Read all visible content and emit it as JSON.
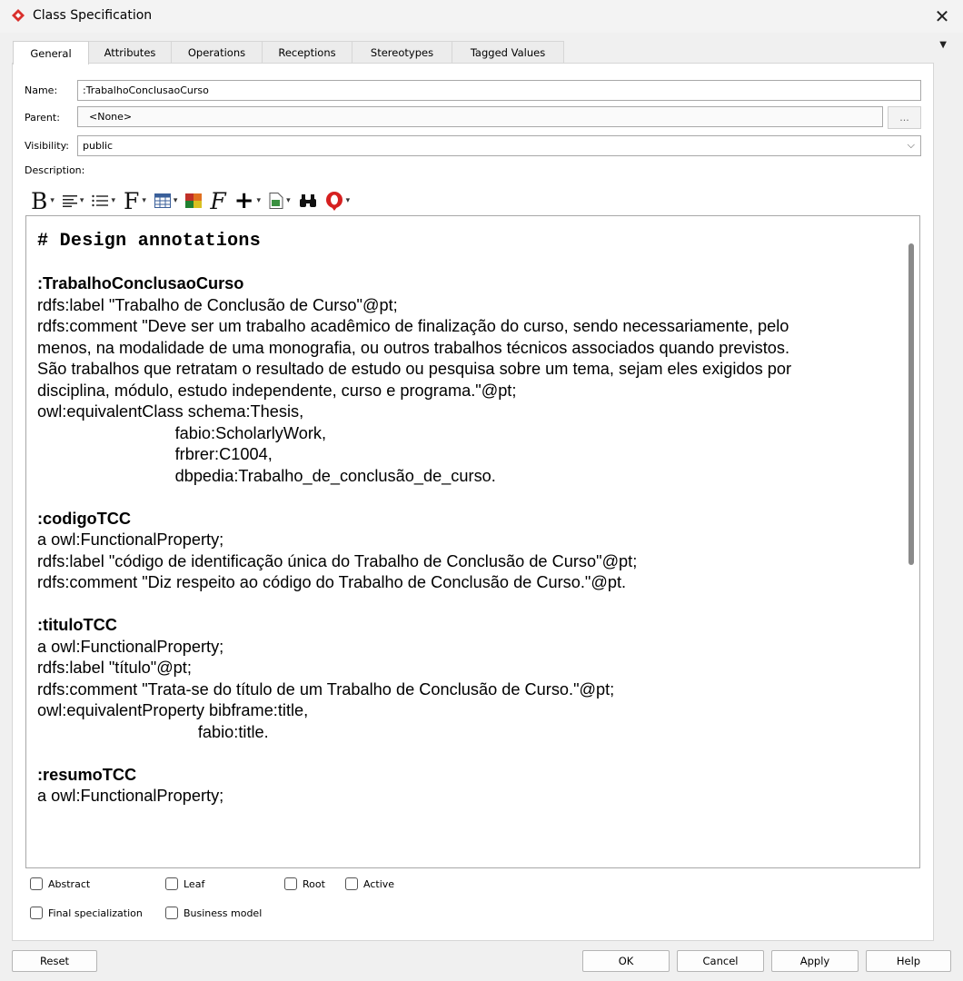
{
  "window": {
    "title": "Class Specification"
  },
  "tabs": [
    {
      "label": "General",
      "active": true
    },
    {
      "label": "Attributes"
    },
    {
      "label": "Operations"
    },
    {
      "label": "Receptions"
    },
    {
      "label": "Stereotypes"
    },
    {
      "label": "Tagged Values"
    }
  ],
  "form": {
    "name_label": "Name:",
    "name_value": ":TrabalhoConclusaoCurso",
    "parent_label": "Parent:",
    "parent_value": "<None>",
    "parent_button": "...",
    "visibility_label": "Visibility:",
    "visibility_value": "public",
    "description_label": "Description:"
  },
  "toolbar_icons": [
    "bold-icon",
    "align-icon",
    "list-icon",
    "font-icon",
    "table-icon",
    "color-icon",
    "formula-icon",
    "insert-icon",
    "document-icon",
    "find-icon",
    "spellcheck-icon"
  ],
  "description": {
    "heading": "# Design annotations",
    "blocks": [
      {
        "title": ":TrabalhoConclusaoCurso",
        "lines": [
          "rdfs:label \"Trabalho de Conclusão de Curso\"@pt;",
          "rdfs:comment \"Deve ser um trabalho acadêmico de finalização do curso, sendo necessariamente, pelo",
          "menos, na modalidade de uma monografia, ou outros trabalhos técnicos associados quando previstos.",
          "São trabalhos que retratam o resultado de estudo ou pesquisa sobre um tema, sejam eles exigidos por",
          "disciplina, módulo, estudo independente, curso e programa.\"@pt;",
          "owl:equivalentClass schema:Thesis,",
          "                              fabio:ScholarlyWork,",
          "                              frbrer:C1004,",
          "                              dbpedia:Trabalho_de_conclusão_de_curso."
        ]
      },
      {
        "title": ":codigoTCC",
        "lines": [
          "a owl:FunctionalProperty;",
          "rdfs:label \"código de identificação única do Trabalho de Conclusão de Curso\"@pt;",
          "rdfs:comment \"Diz respeito ao código do Trabalho de Conclusão de Curso.\"@pt."
        ]
      },
      {
        "title": ":tituloTCC",
        "lines": [
          "a owl:FunctionalProperty;",
          "rdfs:label \"título\"@pt;",
          "rdfs:comment \"Trata-se do título de um Trabalho de Conclusão de Curso.\"@pt;",
          "owl:equivalentProperty bibframe:title,",
          "                                   fabio:title."
        ]
      },
      {
        "title": ":resumoTCC",
        "lines": [
          "a owl:FunctionalProperty;"
        ]
      }
    ]
  },
  "checkboxes": {
    "abstract": "Abstract",
    "leaf": "Leaf",
    "root": "Root",
    "active": "Active",
    "final_specialization": "Final specialization",
    "business_model": "Business model"
  },
  "buttons": {
    "reset": "Reset",
    "ok": "OK",
    "cancel": "Cancel",
    "apply": "Apply",
    "help": "Help"
  },
  "colors": {
    "app_icon": "#d9302c",
    "spellcheck_icon": "#d62020",
    "panel_bg": "#ffffff",
    "window_bg": "#f0f0f0"
  }
}
